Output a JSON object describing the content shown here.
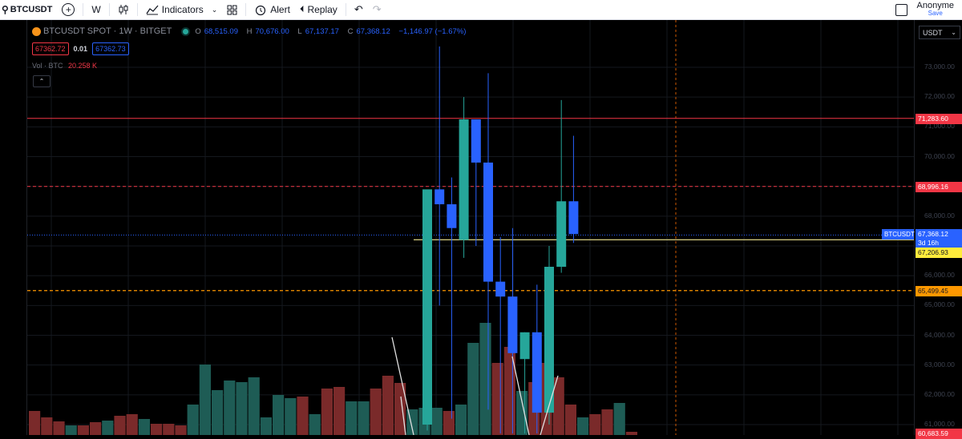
{
  "toolbar": {
    "symbol": "BTCUSDT",
    "interval": "W",
    "indicators": "Indicators",
    "alert": "Alert",
    "replay": "Replay",
    "user": "Anonyme",
    "save": "Save"
  },
  "legend": {
    "title": "BTCUSDT SPOT · 1W · BITGET",
    "o_key": "O",
    "o_val": "68,515.09",
    "h_key": "H",
    "h_val": "70,676.00",
    "l_key": "L",
    "l_val": "67,137.17",
    "c_key": "C",
    "c_val": "67,368.12",
    "change": "−1,146.97 (−1.67%)"
  },
  "trade": {
    "sell": "67362.72",
    "spread": "0.01",
    "buy": "67362.73"
  },
  "volume": {
    "label": "Vol · BTC",
    "value": "20.258 K"
  },
  "price_axis": {
    "currency": "USDT",
    "ticks": [
      "73,000.00",
      "72,000.00",
      "71,000.00",
      "70,000.00",
      "69,000.00",
      "68,000.00",
      "67,000.00",
      "66,000.00",
      "65,000.00",
      "64,000.00",
      "63,000.00",
      "62,000.00",
      "61,000.00"
    ],
    "labels": {
      "red_line": "71,283.60",
      "red_dashed": "68,996.16",
      "symbol_tag": "BTCUSDT",
      "last_price": "67,368.12",
      "countdown": "3d 16h",
      "yellow_line": "67,206.93",
      "orange_dashed": "65,499.45",
      "bottom": "60,683.59"
    }
  },
  "colors": {
    "up": "#26a69a",
    "down": "#2962ff",
    "red_line": "#f23645",
    "orange": "#ff9800",
    "yellow": "#ffeb3b",
    "vol_up": "#1e5c55",
    "vol_down": "#7a2a2a"
  },
  "chart_data": {
    "type": "candlestick",
    "ylim": [
      60683.59,
      73900
    ],
    "candles": [
      {
        "o": 61000,
        "h": 64100,
        "l": 60800,
        "c": 68900
      },
      {
        "o": 68900,
        "h": 73700,
        "l": 65000,
        "c": 68400
      },
      {
        "o": 68400,
        "h": 69300,
        "l": 61200,
        "c": 67600
      },
      {
        "o": 67200,
        "h": 72000,
        "l": 66600,
        "c": 71250
      },
      {
        "o": 71250,
        "h": 71250,
        "l": 67000,
        "c": 69800
      },
      {
        "o": 69800,
        "h": 72800,
        "l": 61500,
        "c": 65800
      },
      {
        "o": 65800,
        "h": 67300,
        "l": 60700,
        "c": 65300
      },
      {
        "o": 65300,
        "h": 67600,
        "l": 60700,
        "c": 63400
      },
      {
        "o": 63200,
        "h": 64100,
        "l": 60700,
        "c": 64100
      },
      {
        "o": 64100,
        "h": 65700,
        "l": 60700,
        "c": 61400
      },
      {
        "o": 61400,
        "h": 67000,
        "l": 61000,
        "c": 66300
      },
      {
        "o": 66300,
        "h": 71900,
        "l": 66100,
        "c": 68500
      },
      {
        "o": 68500,
        "h": 70700,
        "l": 67100,
        "c": 67400
      }
    ],
    "volume": [
      {
        "v": 30,
        "up": false
      },
      {
        "v": 22,
        "up": false
      },
      {
        "v": 17,
        "up": false
      },
      {
        "v": 12,
        "up": true
      },
      {
        "v": 12,
        "up": false
      },
      {
        "v": 16,
        "up": false
      },
      {
        "v": 18,
        "up": true
      },
      {
        "v": 24,
        "up": false
      },
      {
        "v": 26,
        "up": false
      },
      {
        "v": 20,
        "up": true
      },
      {
        "v": 14,
        "up": false
      },
      {
        "v": 14,
        "up": false
      },
      {
        "v": 12,
        "up": false
      },
      {
        "v": 38,
        "up": true
      },
      {
        "v": 88,
        "up": true
      },
      {
        "v": 56,
        "up": true
      },
      {
        "v": 68,
        "up": true
      },
      {
        "v": 66,
        "up": true
      },
      {
        "v": 72,
        "up": true
      },
      {
        "v": 22,
        "up": true
      },
      {
        "v": 50,
        "up": true
      },
      {
        "v": 46,
        "up": true
      },
      {
        "v": 48,
        "up": false
      },
      {
        "v": 26,
        "up": true
      },
      {
        "v": 58,
        "up": false
      },
      {
        "v": 60,
        "up": false
      },
      {
        "v": 42,
        "up": true
      },
      {
        "v": 42,
        "up": true
      },
      {
        "v": 58,
        "up": false
      },
      {
        "v": 74,
        "up": false
      },
      {
        "v": 65,
        "up": false
      },
      {
        "v": 32,
        "up": true
      },
      {
        "v": 34,
        "up": true
      },
      {
        "v": 34,
        "up": true
      },
      {
        "v": 30,
        "up": false
      },
      {
        "v": 38,
        "up": true
      },
      {
        "v": 115,
        "up": true
      },
      {
        "v": 140,
        "up": true
      },
      {
        "v": 90,
        "up": false
      },
      {
        "v": 110,
        "up": false
      },
      {
        "v": 55,
        "up": true
      },
      {
        "v": 66,
        "up": false
      },
      {
        "v": 90,
        "up": false
      },
      {
        "v": 72,
        "up": false
      },
      {
        "v": 38,
        "up": false
      },
      {
        "v": 22,
        "up": true
      },
      {
        "v": 26,
        "up": false
      },
      {
        "v": 32,
        "up": false
      },
      {
        "v": 40,
        "up": true
      },
      {
        "v": 4,
        "up": false
      }
    ]
  }
}
